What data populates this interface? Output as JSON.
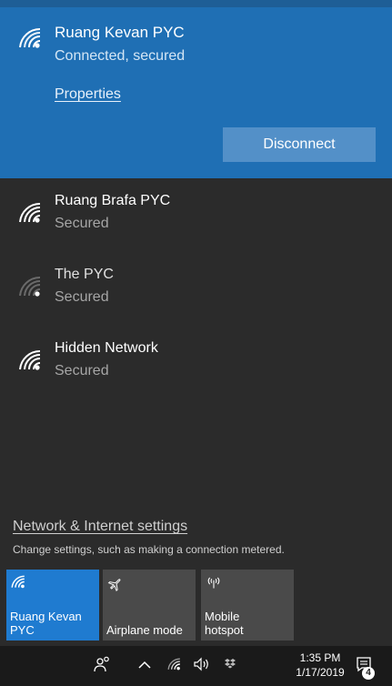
{
  "connected_network": {
    "name": "Ruang Kevan PYC",
    "status": "Connected, secured",
    "properties_label": "Properties",
    "disconnect_label": "Disconnect"
  },
  "networks": [
    {
      "name": "Ruang Brafa PYC",
      "status": "Secured"
    },
    {
      "name": "The PYC",
      "status": "Secured"
    },
    {
      "name": "Hidden Network",
      "status": "Secured"
    }
  ],
  "settings": {
    "link_label": "Network & Internet settings",
    "description": "Change settings, such as making a connection metered."
  },
  "quick_actions": {
    "wifi_label_line1": "Ruang Kevan",
    "wifi_label_line2": "PYC",
    "airplane_label": "Airplane mode",
    "hotspot_label_line1": "Mobile",
    "hotspot_label_line2": "hotspot"
  },
  "taskbar": {
    "time": "1:35 PM",
    "date": "1/17/2019",
    "notification_count": "4",
    "icons": [
      "people-icon",
      "chevron-up-icon",
      "wifi-icon",
      "volume-icon",
      "dropbox-icon",
      "action-center-icon"
    ]
  },
  "colors": {
    "accent": "#1f6fb4",
    "tile_active": "#1f7bd0",
    "flyout_bg": "#2b2b2b",
    "taskbar_bg": "#1a1a1a"
  }
}
